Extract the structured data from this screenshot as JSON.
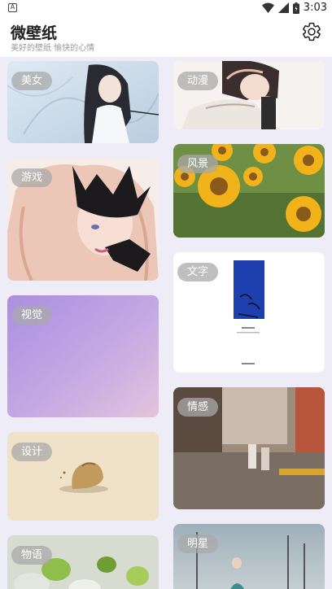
{
  "status_bar": {
    "notification_icon": "A",
    "time": "3:03"
  },
  "header": {
    "title": "微壁纸",
    "subtitle": "美好的壁纸 愉快的心情",
    "settings_icon": "gear-icon"
  },
  "categories": [
    {
      "label": "美女"
    },
    {
      "label": "动漫"
    },
    {
      "label": "游戏"
    },
    {
      "label": "风景"
    },
    {
      "label": "视觉"
    },
    {
      "label": "文字"
    },
    {
      "label": "设计"
    },
    {
      "label": "情感"
    },
    {
      "label": "物语"
    },
    {
      "label": "明星"
    }
  ]
}
